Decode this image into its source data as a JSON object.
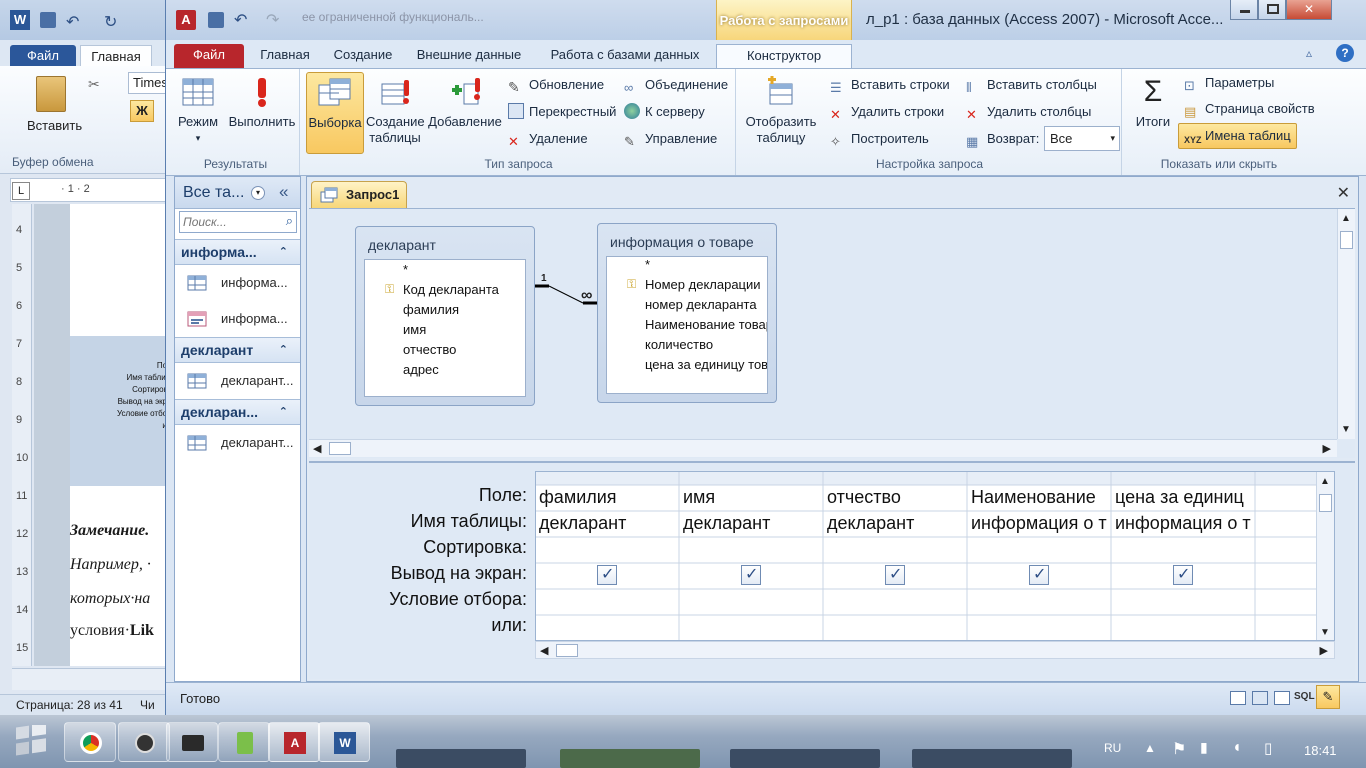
{
  "word": {
    "tabs": [
      "Файл",
      "Главная"
    ],
    "font_box": "Times",
    "paste_label": "Вставить",
    "clipboard_group": "Буфер обмена",
    "bold_button": "Ж",
    "ruler_marks": "· 1 · 2",
    "vertical_ruler": [
      "4",
      "5",
      "6",
      "7",
      "8",
      "9",
      "10",
      "11",
      "12",
      "13",
      "14",
      "15"
    ],
    "thumb_lines": [
      "Поле",
      "Имя таблицы",
      "Сортировка",
      "Вывод на экран",
      "Условие отбора",
      "или"
    ],
    "note_label": "Замечание.",
    "body_lines": [
      "Например, ·",
      "которых·на",
      "условия·"
    ],
    "like_word": "Lik",
    "status_page": "Страница: 28 из 41",
    "status_extra": "Чи"
  },
  "access": {
    "window_title": "л_р1 : база данных (Access 2007)  -  Microsoft Acce...",
    "ghost_title": "ее ограниченной функциональ...",
    "contextual_header": "Работа с запросами",
    "tabs": {
      "file": "Файл",
      "home": "Главная",
      "create": "Создание",
      "external": "Внешние данные",
      "dbtools": "Работа с базами данных",
      "design": "Конструктор"
    },
    "ribbon": {
      "results": {
        "label": "Результаты",
        "view": "Режим",
        "run": "Выполнить"
      },
      "query_type": {
        "label": "Тип запроса",
        "select": "Выборка",
        "make_table": "Создание таблицы",
        "append": "Добавление",
        "update": "Обновление",
        "crosstab": "Перекрестный",
        "delete": "Удаление",
        "union": "Объединение",
        "pass_through": "К серверу",
        "data_definition": "Управление"
      },
      "setup": {
        "label": "Настройка запроса",
        "show_table": "Отобразить таблицу",
        "insert_rows": "Вставить строки",
        "delete_rows": "Удалить строки",
        "builder": "Построитель",
        "insert_cols": "Вставить столбцы",
        "delete_cols": "Удалить столбцы",
        "return_label": "Возврат:",
        "return_value": "Все"
      },
      "show_hide": {
        "label": "Показать или скрыть",
        "totals": "Итоги",
        "parameters": "Параметры",
        "property_sheet": "Страница свойств",
        "table_names": "Имена таблиц"
      }
    },
    "nav": {
      "header": "Все та...",
      "search_placeholder": "Поиск...",
      "groups": [
        {
          "title": "информа...",
          "items": [
            {
              "label": "информа...",
              "icon": "table-icon"
            },
            {
              "label": "информа...",
              "icon": "form-icon"
            }
          ]
        },
        {
          "title": "декларант",
          "items": [
            {
              "label": "декларант...",
              "icon": "table-icon"
            }
          ]
        },
        {
          "title": "декларан...",
          "items": [
            {
              "label": "декларант...",
              "icon": "table-icon"
            }
          ]
        }
      ]
    },
    "query_tab": "Запрос1",
    "tables": [
      {
        "title": "декларант",
        "fields": [
          "*",
          "Код декларанта",
          "фамилия",
          "имя",
          "отчество",
          "адрес"
        ],
        "key_field": "Код декларанта"
      },
      {
        "title": "информация о товаре",
        "fields": [
          "*",
          "Номер декларации",
          "номер декларанта",
          "Наименование товар",
          "количество",
          "цена за единицу това"
        ],
        "key_field": "Номер декларации"
      }
    ],
    "relationship": {
      "one": "1",
      "many": "∞"
    },
    "grid": {
      "row_labels": [
        "Поле:",
        "Имя таблицы:",
        "Сортировка:",
        "Вывод на экран:",
        "Условие отбора:",
        "или:"
      ],
      "columns": [
        {
          "field": "фамилия",
          "table": "декларант",
          "show": true
        },
        {
          "field": "имя",
          "table": "декларант",
          "show": true
        },
        {
          "field": "отчество",
          "table": "декларант",
          "show": true
        },
        {
          "field": "Наименование",
          "table": "информация о т",
          "show": true
        },
        {
          "field": "цена за единиц",
          "table": "информация о т",
          "show": true
        },
        {
          "field": "",
          "table": "",
          "show": false
        }
      ]
    },
    "status_text": "Готово"
  },
  "taskbar": {
    "language": "RU",
    "time": "18:41"
  },
  "colors": {
    "accent": "#b8262c",
    "selected_button": "#f8c860",
    "ribbon_bg": "#e7eff8"
  }
}
